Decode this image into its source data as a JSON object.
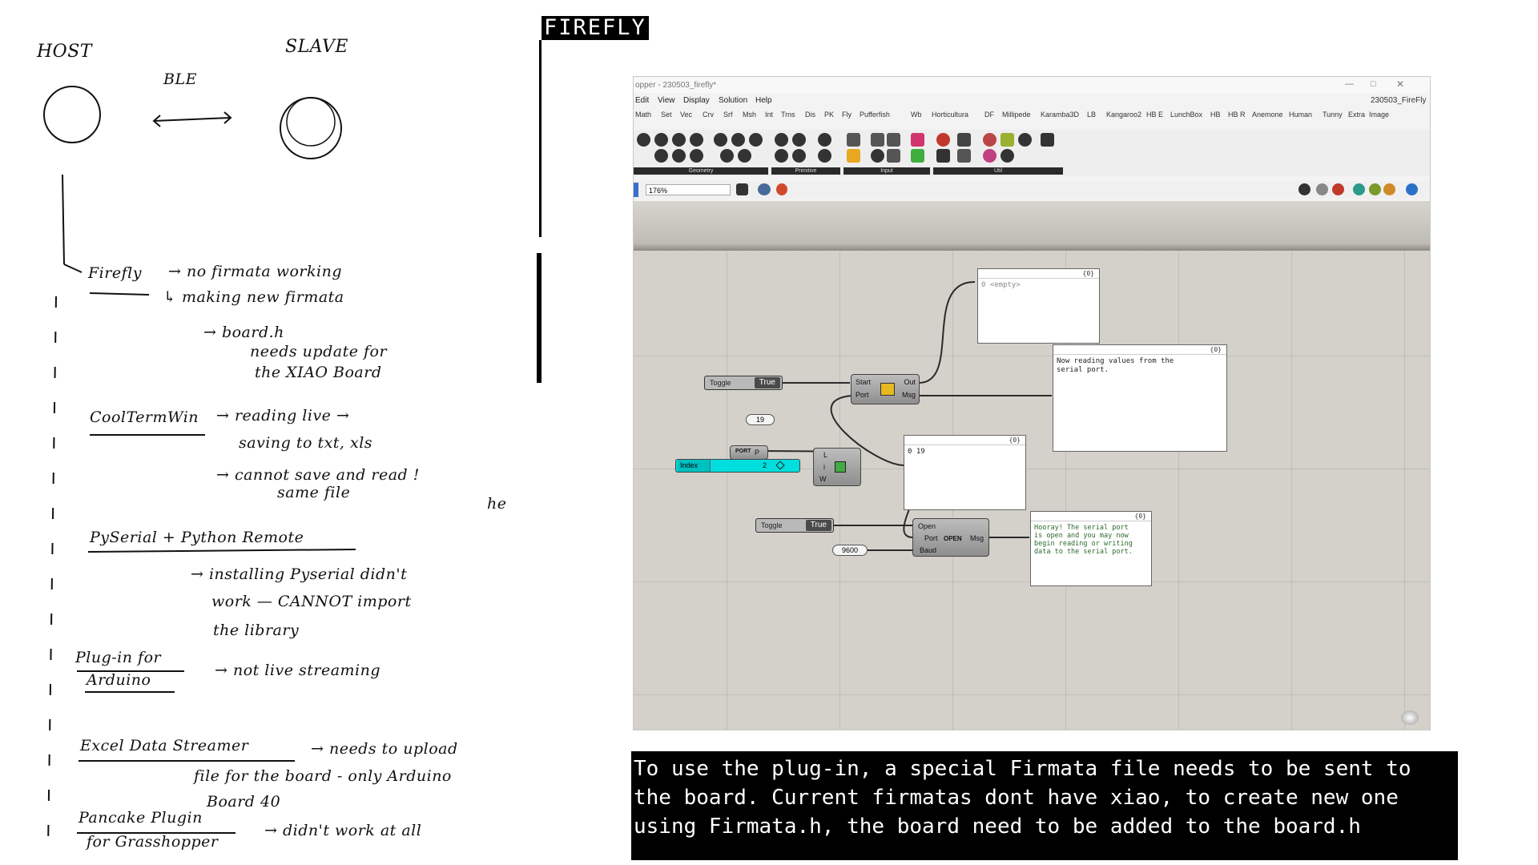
{
  "notes": {
    "host": "HOST",
    "slave": "SLAVE",
    "ble": "BLE",
    "items": [
      {
        "title": "Firefly",
        "lines": [
          "→ no firmata working",
          "↳ making new firmata",
          "→ board.h",
          "needs update for",
          "the XIAO Board"
        ]
      },
      {
        "title": "CoolTermWin",
        "lines": [
          "→ reading live →",
          "saving to txt, xls",
          "→ cannot save and read !",
          "same file"
        ]
      },
      {
        "title": "PySerial + Python Remote",
        "lines": [
          "→ installing Pyserial didn't",
          "work — CANNOT import",
          "the library"
        ]
      },
      {
        "title": "Plug-in for",
        "title2": "Arduino",
        "lines": [
          "→ not live streaming"
        ]
      },
      {
        "title": "Excel Data Streamer",
        "lines": [
          "→ needs to upload",
          "file for the board - only Arduino",
          "Board 40"
        ]
      },
      {
        "title": "Pancake Plugin",
        "title2": "for Grasshopper",
        "lines": [
          "→ didn't work at all"
        ]
      }
    ],
    "stray": "he"
  },
  "heading": "FIREFLY",
  "grasshopper": {
    "window_title": "opper - 230503_firefly*",
    "doc_name": "230503_FireFly",
    "menu": [
      "Edit",
      "View",
      "Display",
      "Solution",
      "Help"
    ],
    "tabs": [
      "Math",
      "Set",
      "Vec",
      "Crv",
      "Srf",
      "Msh",
      "Int",
      "Trns",
      "Dis",
      "PK",
      "Fly",
      "Pufferfish",
      "Wb",
      "Horticultura",
      "DF",
      "Millipede",
      "Karamba3D",
      "LB",
      "Kangaroo2",
      "HB E",
      "LunchBox",
      "HB",
      "HB R",
      "Anemone",
      "Human",
      "Tunny",
      "Extra",
      "Image"
    ],
    "ribbon_groups": [
      "Geometry",
      "Primitive",
      "Input",
      "Util"
    ],
    "zoom": "176%",
    "panels": {
      "empty": {
        "header": "{0}",
        "text": "0 <empty>"
      },
      "reading": {
        "header": "{0}",
        "text": "Now reading values from the serial port."
      },
      "port": {
        "header": "{0}",
        "text": "0 19"
      },
      "hooray": {
        "header": "{0}",
        "text": "Hooray! The serial port is open and you may now begin reading or writing data to the serial port."
      }
    },
    "toggle_label": "Toggle",
    "toggle_value": "True",
    "read_comp": {
      "in1": "Start",
      "in2": "Port",
      "out1": "Out",
      "out2": "Msg"
    },
    "item_comp": {
      "in1": "L",
      "in2": "i",
      "in3": "W"
    },
    "open_comp": {
      "in1": "Open",
      "in2": "Port",
      "in3": "Baud",
      "out": "Msg",
      "badge": "OPEN"
    },
    "port_number": "19",
    "baud": "9600",
    "slider_label": "Index",
    "slider_value": "2",
    "ports_label": "PORT"
  },
  "caption": [
    "To use the plug-in, a special Firmata file needs to be sent to",
    "the board. Current firmatas dont have xiao, to create new one",
    "using Firmata.h, the board need to be added to the board.h"
  ]
}
